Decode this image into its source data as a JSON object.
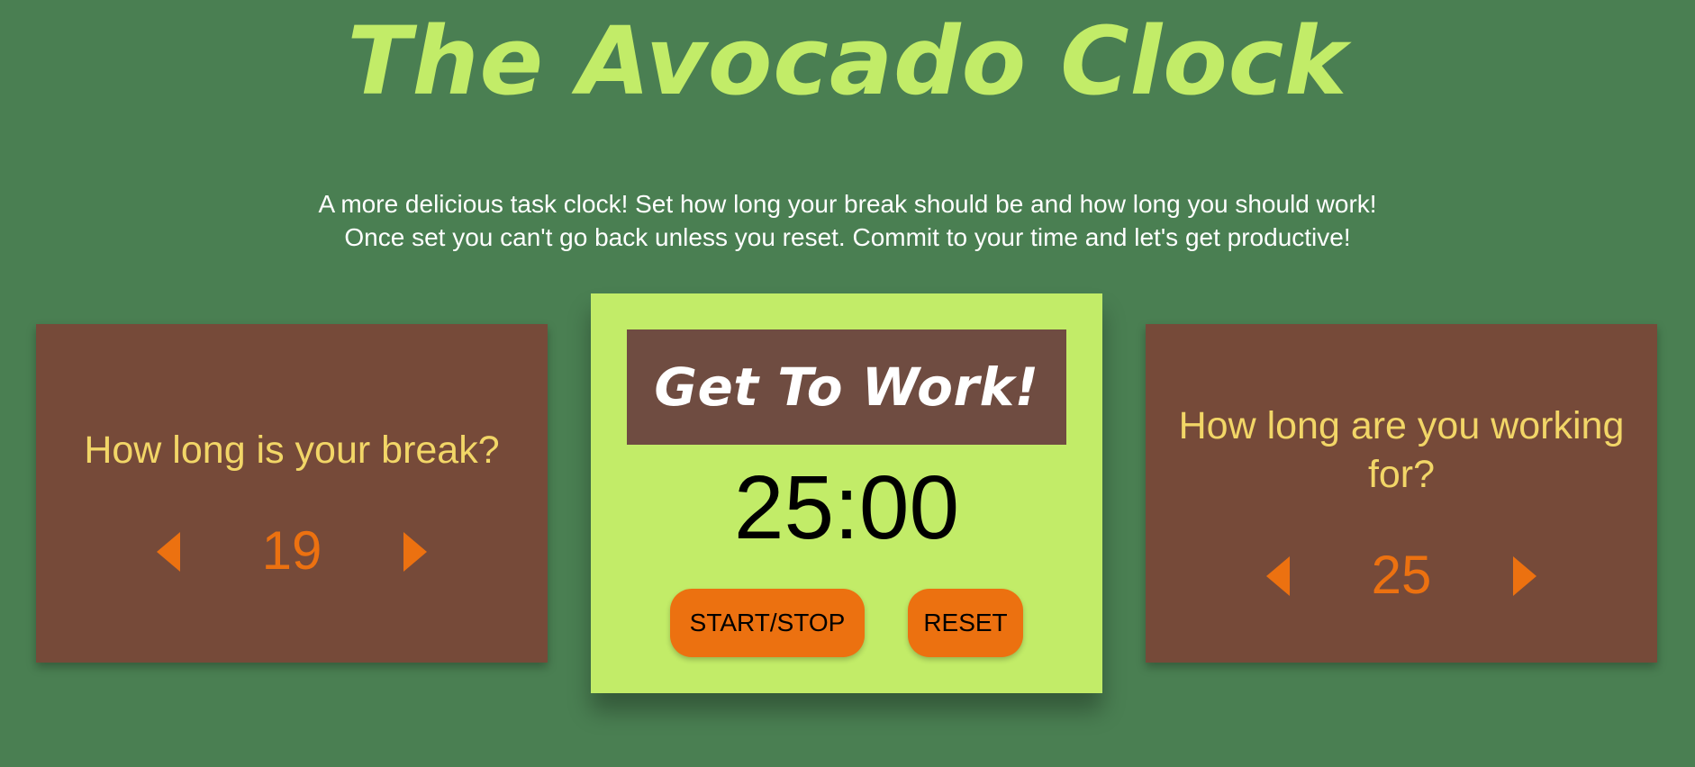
{
  "header": {
    "title": "The Avocado Clock"
  },
  "description": {
    "line1": "A more delicious task clock! Set how long your break should be and how long you should work!",
    "line2": "Once set you can't go back unless you reset. Commit to your time and let's get productive!"
  },
  "break_card": {
    "question": "How long is your break?",
    "value": "19",
    "decrement_icon": "caret-left-icon",
    "increment_icon": "caret-right-icon"
  },
  "work_card": {
    "question": "How long are you working for?",
    "value": "25",
    "decrement_icon": "caret-left-icon",
    "increment_icon": "caret-right-icon"
  },
  "clock": {
    "status": "Get To Work!",
    "time": "25:00",
    "start_stop_label": "START/STOP",
    "reset_label": "RESET"
  },
  "colors": {
    "background": "#4a7f52",
    "title": "#c2ec68",
    "side_card": "#764a39",
    "question_text": "#f2d667",
    "accent_orange": "#ec7110",
    "clock_card": "#c2ec68",
    "status_box": "#6f4c41"
  }
}
